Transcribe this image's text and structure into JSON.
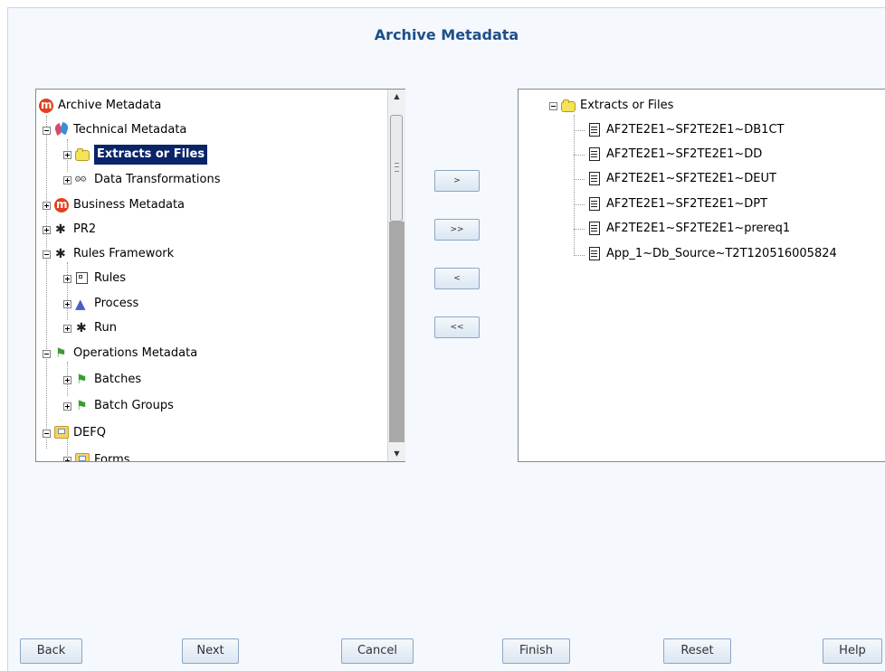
{
  "page": {
    "title": "Archive Metadata"
  },
  "left_tree": {
    "items": [
      {
        "label": "Archive Metadata",
        "icon": "archive-icon"
      },
      {
        "label": "Technical Metadata",
        "icon": "technical-metadata-icon"
      },
      {
        "label": "Extracts or Files",
        "icon": "folder-icon",
        "selected": true
      },
      {
        "label": "Data Transformations",
        "icon": "gears-icon"
      },
      {
        "label": "Business Metadata",
        "icon": "archive-icon"
      },
      {
        "label": "PR2",
        "icon": "runner-icon"
      },
      {
        "label": "Rules Framework",
        "icon": "runner-icon"
      },
      {
        "label": "Rules",
        "icon": "rules-icon"
      },
      {
        "label": "Process",
        "icon": "process-icon"
      },
      {
        "label": "Run",
        "icon": "runner-icon"
      },
      {
        "label": "Operations Metadata",
        "icon": "operations-icon"
      },
      {
        "label": "Batches",
        "icon": "operations-icon"
      },
      {
        "label": "Batch Groups",
        "icon": "operations-icon"
      },
      {
        "label": "DEFQ",
        "icon": "defq-icon"
      },
      {
        "label": "Forms",
        "icon": "defq-icon"
      }
    ]
  },
  "right_tree": {
    "root": {
      "label": "Extracts or Files",
      "icon": "folder-icon"
    },
    "items": [
      {
        "label": "AF2TE2E1~SF2TE2E1~DB1CT",
        "icon": "document-icon"
      },
      {
        "label": "AF2TE2E1~SF2TE2E1~DD",
        "icon": "document-icon"
      },
      {
        "label": "AF2TE2E1~SF2TE2E1~DEUT",
        "icon": "document-icon"
      },
      {
        "label": "AF2TE2E1~SF2TE2E1~DPT",
        "icon": "document-icon"
      },
      {
        "label": "AF2TE2E1~SF2TE2E1~prereq1",
        "icon": "document-icon"
      },
      {
        "label": "App_1~Db_Source~T2T120516005824",
        "icon": "document-icon"
      }
    ]
  },
  "move_buttons": {
    "add": ">",
    "add_all": ">>",
    "remove": "<",
    "remove_all": "<<"
  },
  "footer": {
    "back": "Back",
    "next": "Next",
    "cancel": "Cancel",
    "finish": "Finish",
    "reset": "Reset",
    "help": "Help"
  },
  "colors": {
    "title": "#1d4f8a",
    "selection": "#0a246a",
    "background": "#f5f8fc"
  }
}
